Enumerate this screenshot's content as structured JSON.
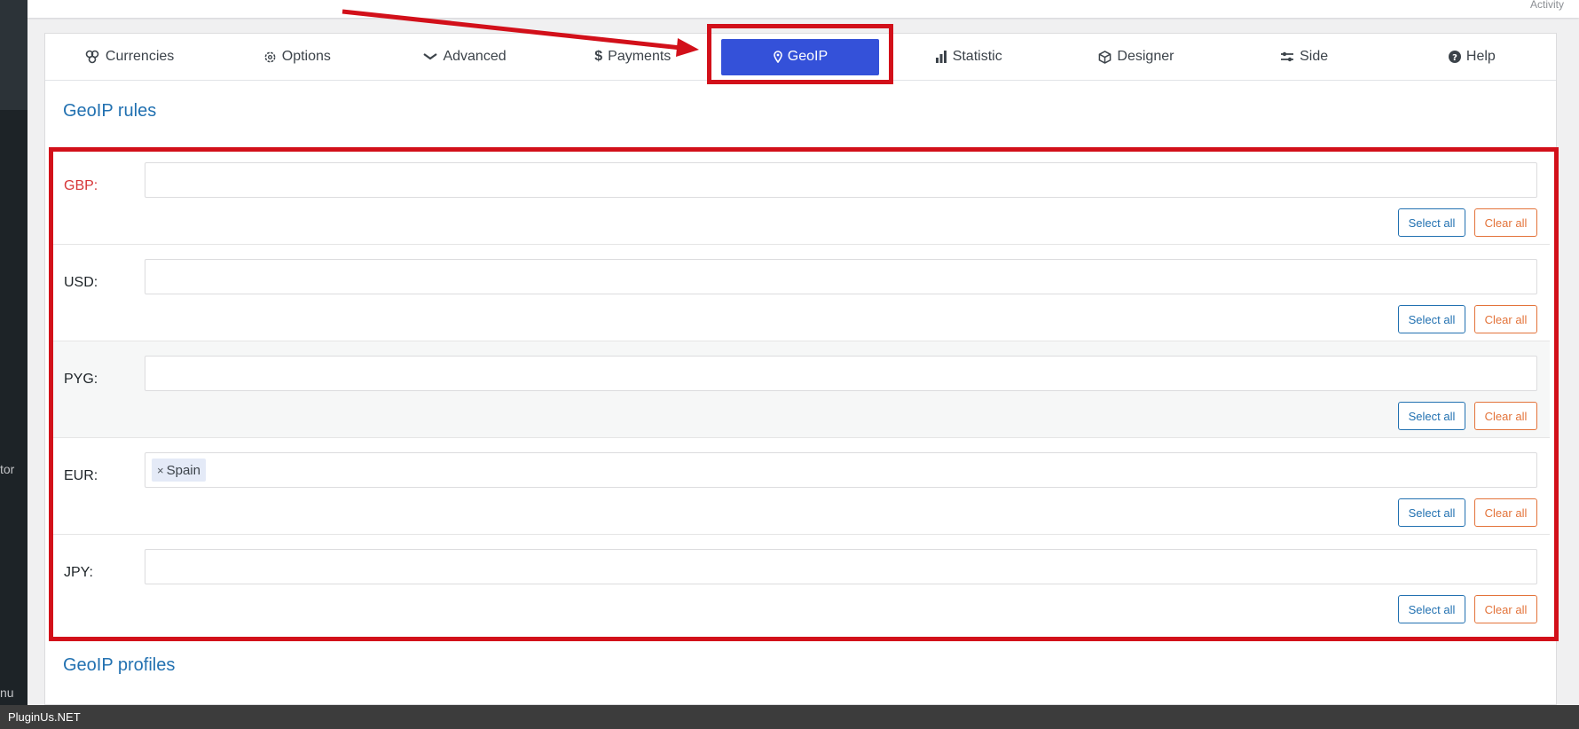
{
  "sidebar": {
    "fragment_1": "tor",
    "fragment_2": "nu"
  },
  "header": {
    "activity": "Activity"
  },
  "tabs": [
    {
      "label": "Currencies",
      "icon": "coins-icon"
    },
    {
      "label": "Options",
      "icon": "gear-icon"
    },
    {
      "label": "Advanced",
      "icon": "chevron-down-icon"
    },
    {
      "label": "Payments",
      "icon": "dollar-icon"
    },
    {
      "label": "GeoIP",
      "icon": "map-pin-icon",
      "active": true
    },
    {
      "label": "Statistic",
      "icon": "bar-chart-icon"
    },
    {
      "label": "Designer",
      "icon": "cube-icon"
    },
    {
      "label": "Side",
      "icon": "sliders-icon"
    },
    {
      "label": "Help",
      "icon": "question-circle-icon"
    }
  ],
  "geoip": {
    "rules_title": "GeoIP rules",
    "profiles_title": "GeoIP profiles",
    "select_all_label": "Select all",
    "clear_all_label": "Clear all",
    "rules": [
      {
        "label": "GBP:",
        "countries": []
      },
      {
        "label": "USD:",
        "countries": []
      },
      {
        "label": "PYG:",
        "countries": []
      },
      {
        "label": "EUR:",
        "countries": [
          "Spain"
        ]
      },
      {
        "label": "JPY:",
        "countries": []
      }
    ],
    "chip_remove": "×"
  },
  "footer": {
    "text": "PluginUs.NET"
  },
  "colors": {
    "accent": "#3451d9",
    "highlight": "#d2101a",
    "link": "#2271b1",
    "danger": "#e3733a"
  }
}
